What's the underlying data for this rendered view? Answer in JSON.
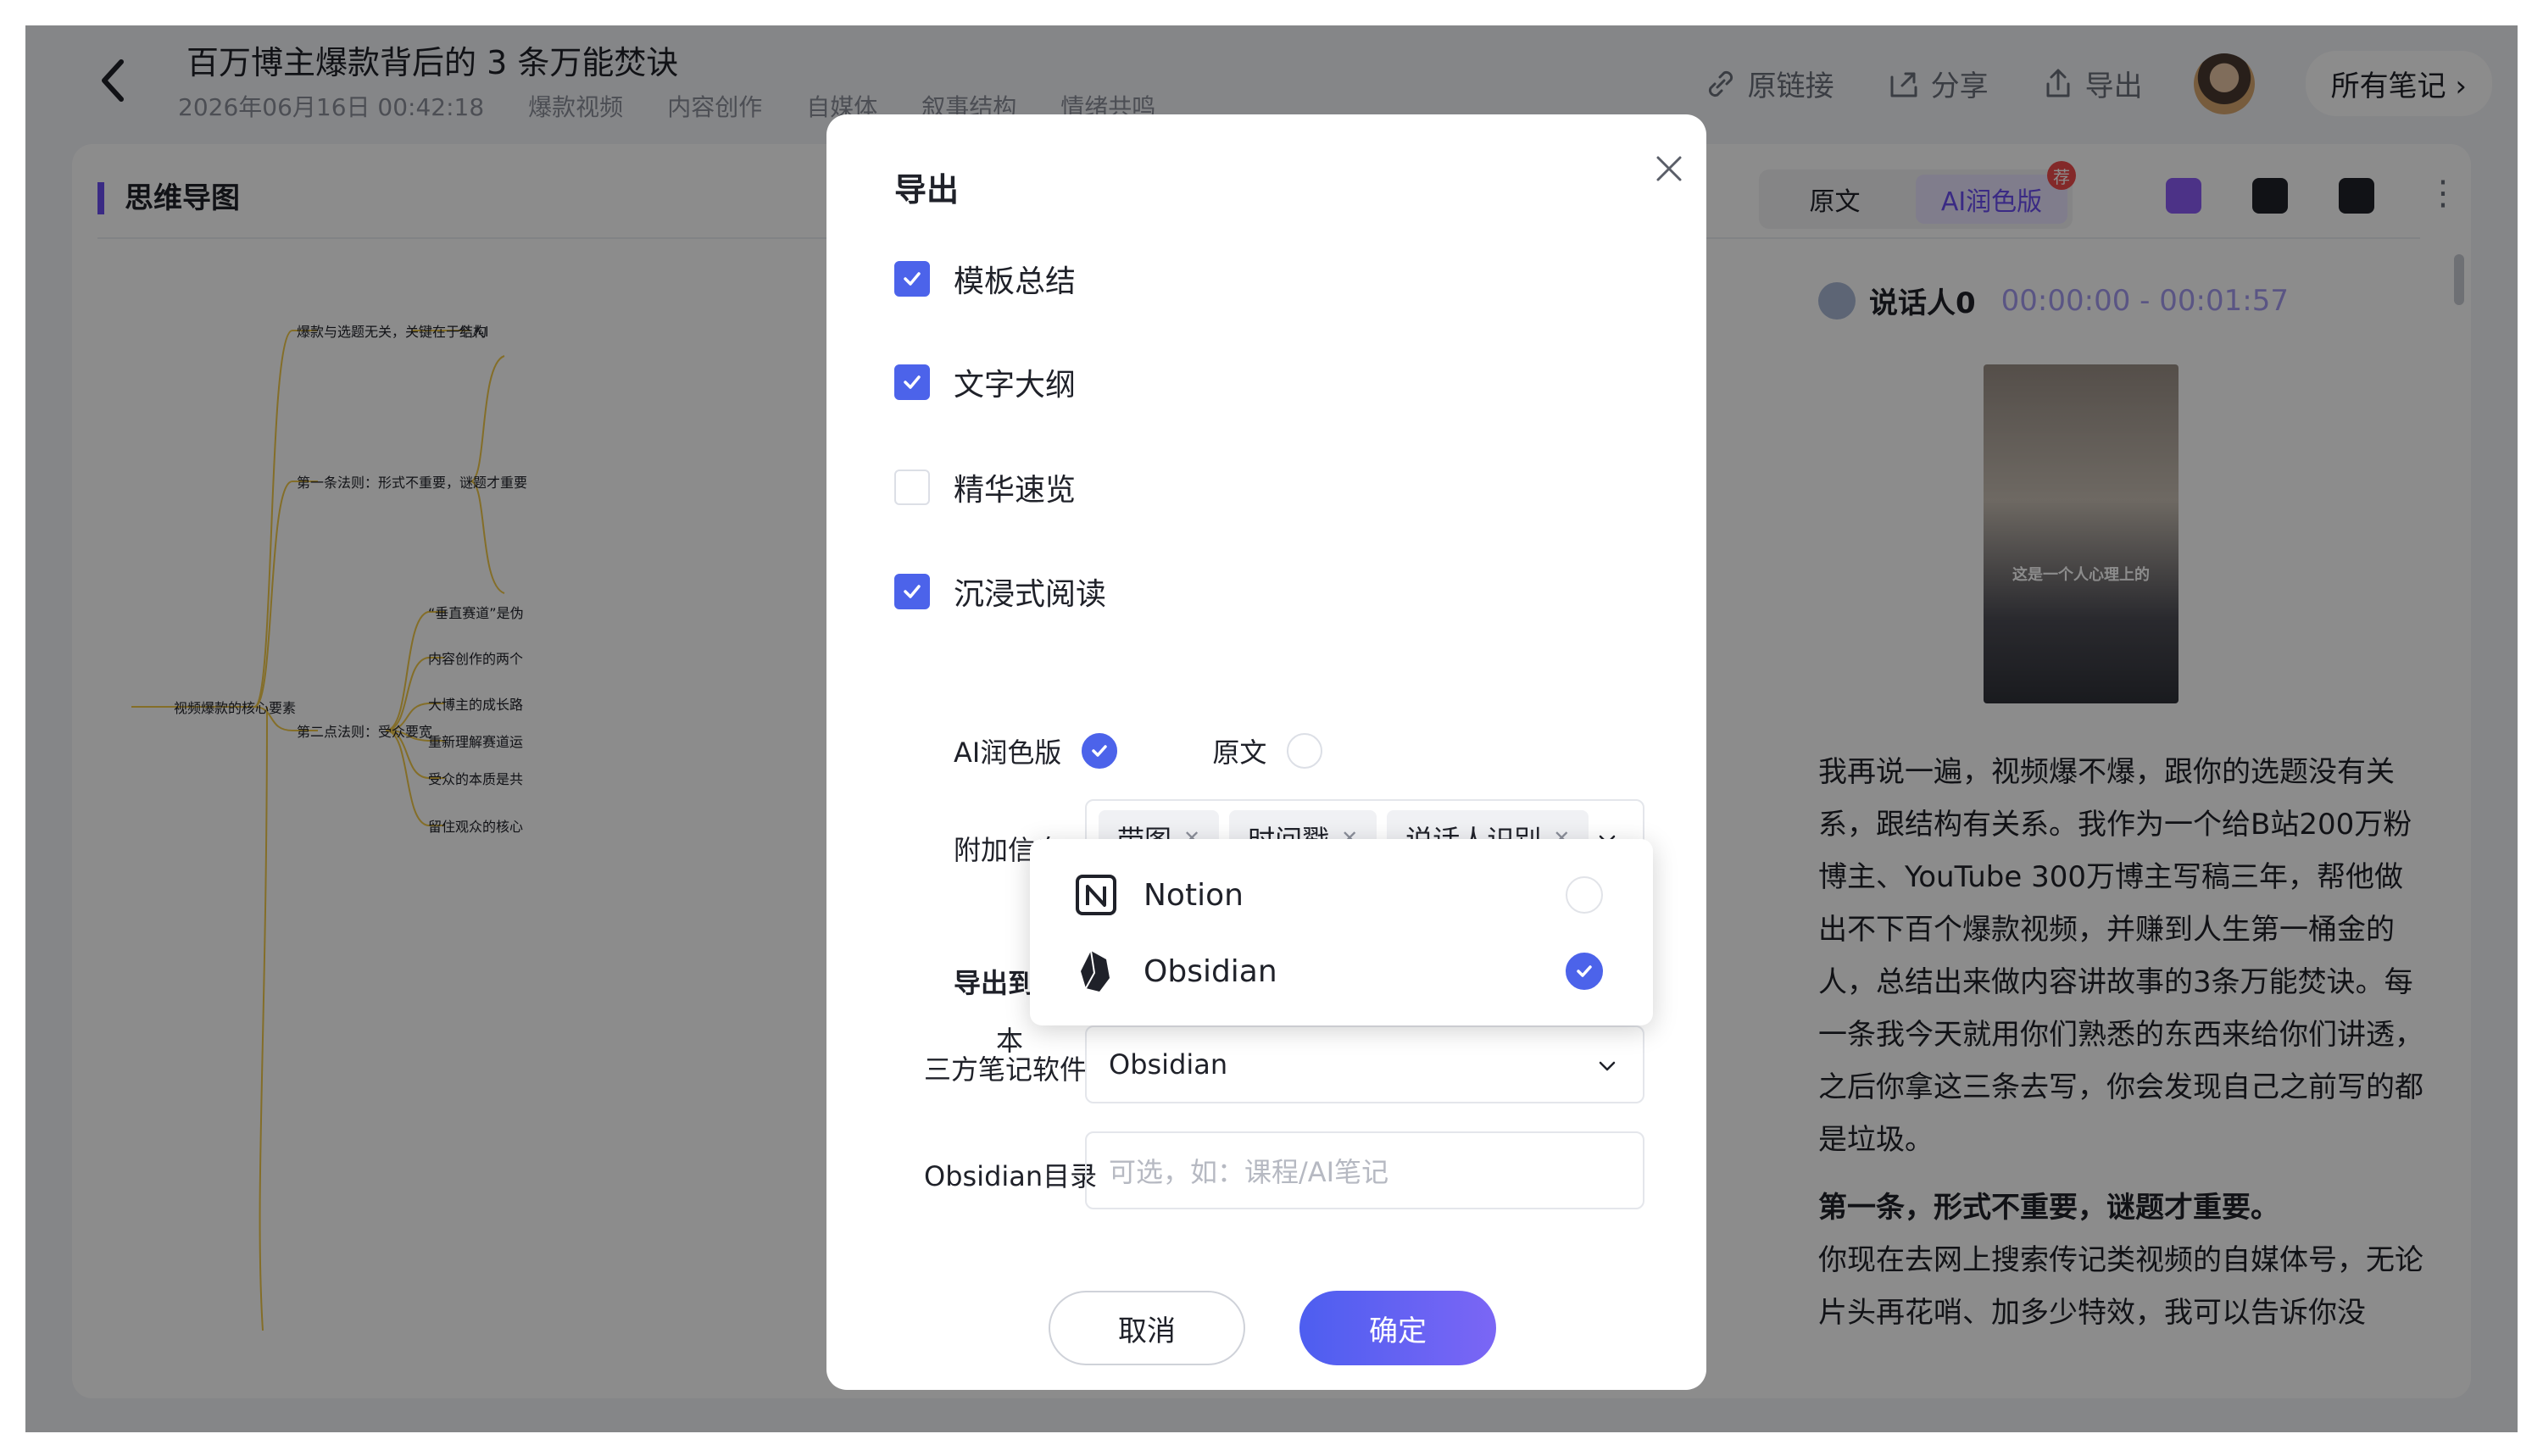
{
  "header": {
    "back_icon": "chevron-left-icon",
    "title": "百万博主爆款背后的 3 条万能焚诀",
    "date": "2026年06月16日 00:42:18",
    "tags": [
      "爆款视频",
      "内容创作",
      "自媒体",
      "叙事结构",
      "情绪共鸣"
    ],
    "actions": {
      "link": "原链接",
      "share": "分享",
      "export": "导出"
    },
    "all_notes": "所有笔记"
  },
  "mindmap": {
    "title": "思维导图",
    "root": "视频爆款的核心要素",
    "branches": [
      "爆款与选题无关，关键在于结构",
      "第一条法则：形式不重要，谜题才重要",
      "第二点法则：受众要宽"
    ],
    "leaf_first": "个人l",
    "leaves_second": [
      "“垂直赛道”是伪",
      "内容创作的两个",
      "大博主的成长路",
      "重新理解赛道运",
      "受众的本质是共",
      "留住观众的核心"
    ]
  },
  "right": {
    "tabs": [
      "原文",
      "AI润色版"
    ],
    "badge": "荐",
    "speaker": "说话人0",
    "time": "00:00:00 - 00:01:57",
    "thumb_caption": "这是一个人心理上的",
    "p1": "我再说一遍，视频爆不爆，跟你的选题没有关系，跟结构有关系。我作为一个给B站200万粉博主、YouTube 300万博主写稿三年，帮他做出不下百个爆款视频，并赚到人生第一桶金的人，总结出来做内容讲故事的3条万能焚诀。每一条我今天就用你们熟悉的东西来给你们讲透，之后你拿这三条去写，你会发现自己之前写的都是垃圾。",
    "p2_heading": "第一条，形式不重要，谜题才重要。",
    "p2": "你现在去网上搜索传记类视频的自媒体号，无论片头再花哨、加多少特效，我可以告诉你没"
  },
  "modal": {
    "title": "导出",
    "checkboxes": [
      {
        "label": "模板总结",
        "checked": true
      },
      {
        "label": "文字大纲",
        "checked": true
      },
      {
        "label": "精华速览",
        "checked": false
      },
      {
        "label": "沉浸式阅读",
        "checked": true
      }
    ],
    "version_ai": "AI润色版",
    "version_original": "原文",
    "version_selected": "AI润色版",
    "extra_label": "附加信息",
    "extra_tags": [
      "带图",
      "时间戳",
      "说话人识别"
    ],
    "export_to_label": "导出到",
    "export_local_fragment": "本",
    "dropdown_options": [
      {
        "label": "Notion",
        "icon": "notion-icon",
        "selected": false
      },
      {
        "label": "Obsidian",
        "icon": "obsidian-icon",
        "selected": true
      }
    ],
    "third_party_label": "三方笔记软件",
    "third_party_value": "Obsidian",
    "dir_label": "Obsidian目录",
    "dir_placeholder": "可选，如：课程/AI笔记",
    "cancel": "取消",
    "confirm": "确定"
  },
  "colors": {
    "accent": "#4c63ea",
    "purple": "#6b4ef0",
    "overlay": "rgba(0,0,0,0.45)"
  }
}
